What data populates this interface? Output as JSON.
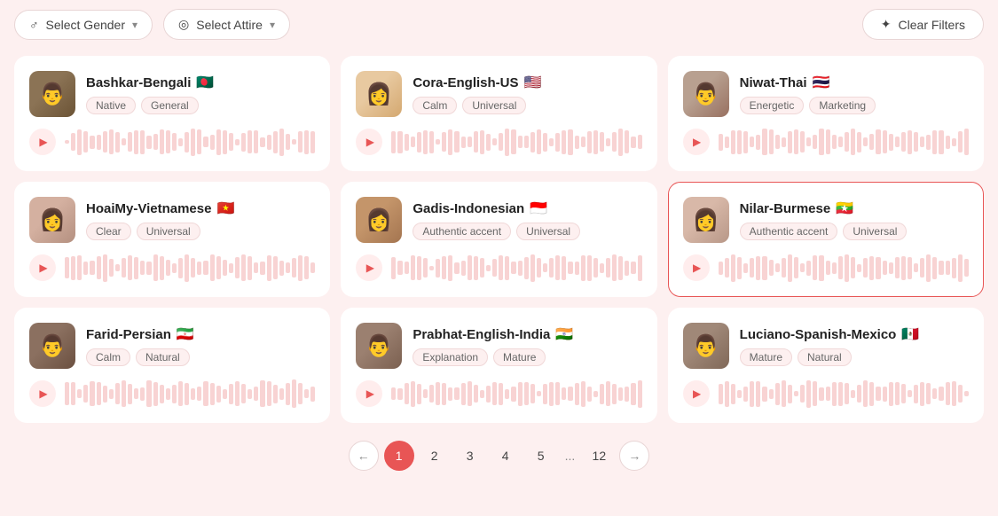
{
  "topbar": {
    "gender_label": "Select Gender",
    "attire_label": "Select Attire",
    "clear_filters_label": "Clear Filters"
  },
  "voices": [
    {
      "id": "bashkar",
      "name": "Bashkar-Bengali",
      "flag": "🇧🇩",
      "tags": [
        "Native",
        "General"
      ],
      "avatar_class": "avatar-bashkar",
      "avatar_emoji": "👨",
      "selected": false
    },
    {
      "id": "cora",
      "name": "Cora-English-US",
      "flag": "🇺🇸",
      "tags": [
        "Calm",
        "Universal"
      ],
      "avatar_class": "avatar-cora",
      "avatar_emoji": "👩",
      "selected": false
    },
    {
      "id": "niwat",
      "name": "Niwat-Thai",
      "flag": "🇹🇭",
      "tags": [
        "Energetic",
        "Marketing"
      ],
      "avatar_class": "avatar-niwat",
      "avatar_emoji": "👨",
      "selected": false
    },
    {
      "id": "hoaimy",
      "name": "HoaiMy-Vietnamese",
      "flag": "🇻🇳",
      "tags": [
        "Clear",
        "Universal"
      ],
      "avatar_class": "avatar-hoaimy",
      "avatar_emoji": "👩",
      "selected": false
    },
    {
      "id": "gadis",
      "name": "Gadis-Indonesian",
      "flag": "🇮🇩",
      "tags": [
        "Authentic accent",
        "Universal"
      ],
      "avatar_class": "avatar-gadis",
      "avatar_emoji": "👩",
      "selected": false
    },
    {
      "id": "nilar",
      "name": "Nilar-Burmese",
      "flag": "🇲🇲",
      "tags": [
        "Authentic accent",
        "Universal"
      ],
      "avatar_class": "avatar-nilar",
      "avatar_emoji": "👩",
      "selected": true
    },
    {
      "id": "farid",
      "name": "Farid-Persian",
      "flag": "🇮🇷",
      "tags": [
        "Calm",
        "Natural"
      ],
      "avatar_class": "avatar-farid",
      "avatar_emoji": "👨",
      "selected": false
    },
    {
      "id": "prabhat",
      "name": "Prabhat-English-India",
      "flag": "🇮🇳",
      "tags": [
        "Explanation",
        "Mature"
      ],
      "avatar_class": "avatar-prabhat",
      "avatar_emoji": "👨",
      "selected": false
    },
    {
      "id": "luciano",
      "name": "Luciano-Spanish-Mexico",
      "flag": "🇲🇽",
      "tags": [
        "Mature",
        "Natural"
      ],
      "avatar_class": "avatar-luciano",
      "avatar_emoji": "👨",
      "selected": false
    }
  ],
  "pagination": {
    "prev_label": "←",
    "next_label": "→",
    "pages": [
      "1",
      "2",
      "3",
      "4",
      "5",
      "...",
      "12"
    ],
    "active_page": "1"
  }
}
